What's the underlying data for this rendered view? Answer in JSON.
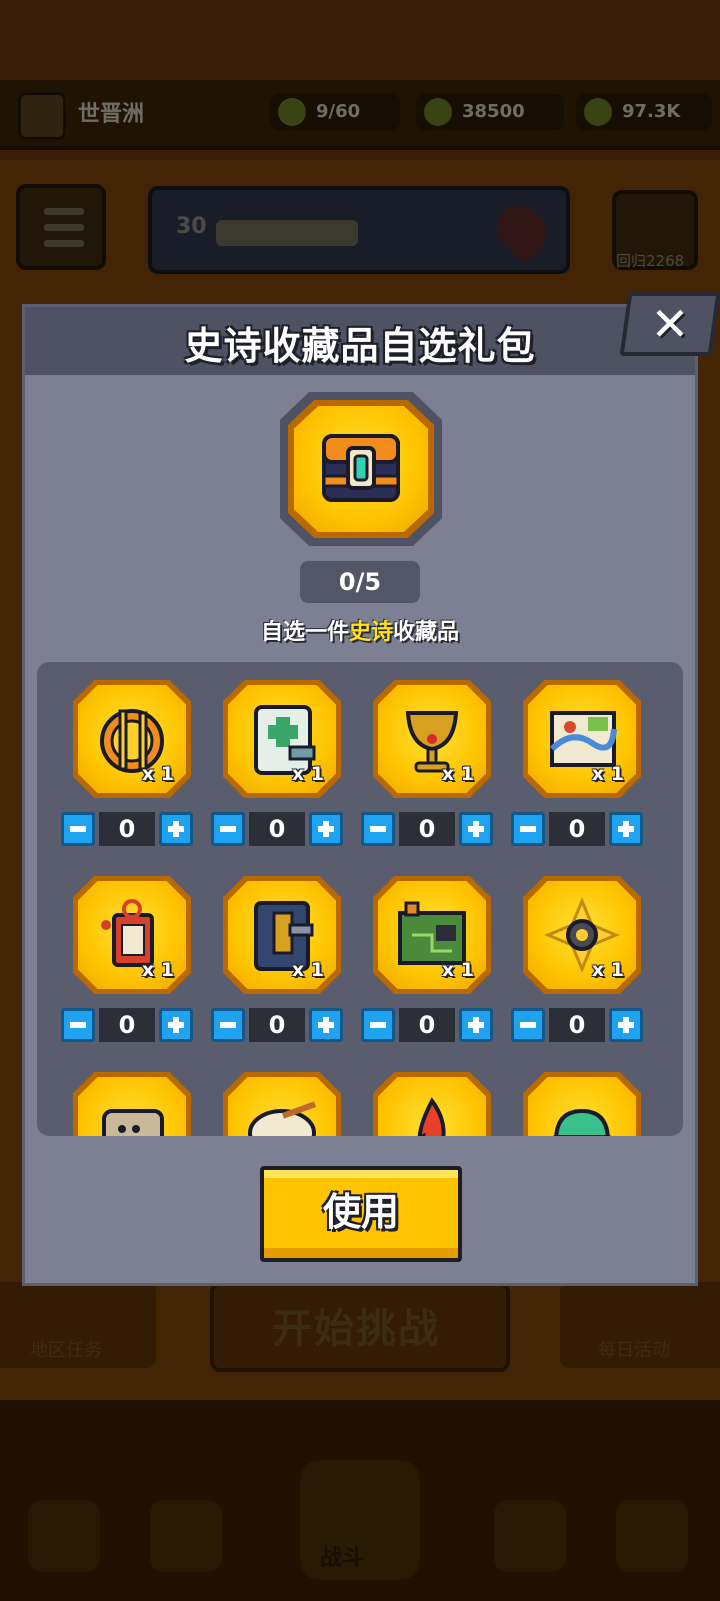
{
  "background": {
    "player_name": "世晋洲",
    "resources": [
      {
        "icon": "energy-icon",
        "value": "9/60"
      },
      {
        "icon": "coin-icon",
        "value": "38500"
      },
      {
        "icon": "gem-icon",
        "value": "97.3K"
      }
    ],
    "banner_level": "30",
    "shield_label": "回归2268",
    "start_button": "开始挑战",
    "left_side_label": "地区任务",
    "right_side_label": "每日活动",
    "battle_label": "战斗"
  },
  "dialog": {
    "title": "史诗收藏品自选礼包",
    "close_icon": "close-icon",
    "chest_icon": "treasure-chest-icon",
    "progress": "0/5",
    "subtitle_prefix": "自选一件",
    "subtitle_highlight": "史诗",
    "subtitle_suffix": "收藏品",
    "highlight_color": "#ffe21a",
    "use_button": "使用",
    "items": [
      {
        "icon": "golden-cutlery-icon",
        "qty": "x 1",
        "count": "0"
      },
      {
        "icon": "medical-notebook-icon",
        "qty": "x 1",
        "count": "0"
      },
      {
        "icon": "golden-chalice-icon",
        "qty": "x 1",
        "count": "0"
      },
      {
        "icon": "treasure-map-icon",
        "qty": "x 1",
        "count": "0"
      },
      {
        "icon": "lucky-charm-icon",
        "qty": "x 1",
        "count": "0"
      },
      {
        "icon": "phone-device-icon",
        "qty": "x 1",
        "count": "0"
      },
      {
        "icon": "circuit-board-icon",
        "qty": "x 1",
        "count": "0"
      },
      {
        "icon": "compass-ring-icon",
        "qty": "x 1",
        "count": "0"
      },
      {
        "icon": "ancient-tablet-icon",
        "qty": "",
        "count": ""
      },
      {
        "icon": "bowl-icon",
        "qty": "",
        "count": ""
      },
      {
        "icon": "flame-icon",
        "qty": "",
        "count": ""
      },
      {
        "icon": "helmet-icon",
        "qty": "",
        "count": ""
      }
    ]
  }
}
